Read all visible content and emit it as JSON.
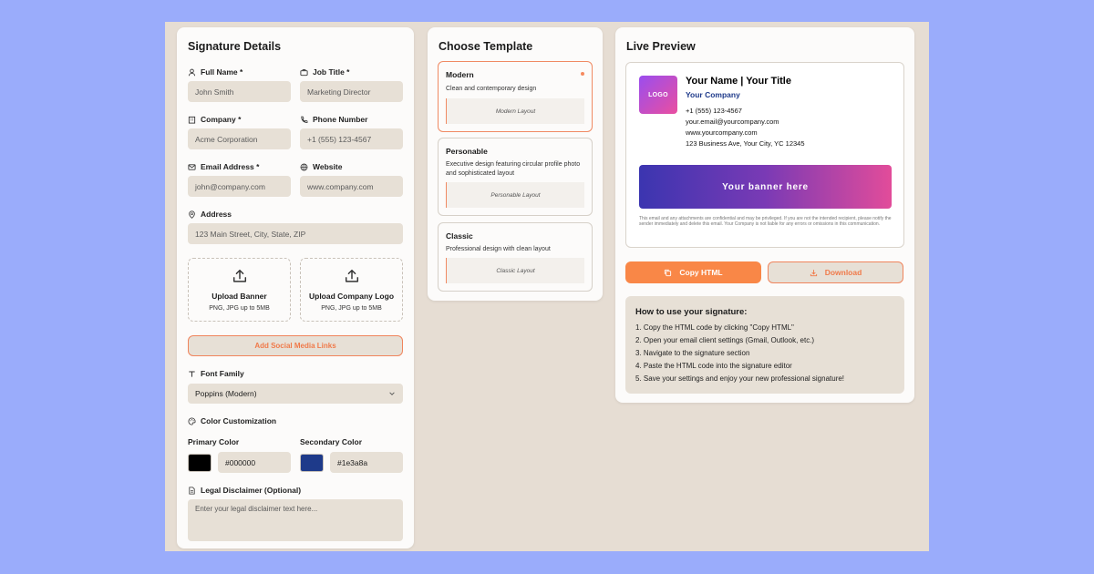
{
  "form": {
    "title": "Signature Details",
    "full_name": {
      "label": "Full Name *",
      "value": "John Smith"
    },
    "job_title": {
      "label": "Job Title *",
      "value": "Marketing Director"
    },
    "company": {
      "label": "Company *",
      "value": "Acme Corporation"
    },
    "phone": {
      "label": "Phone Number",
      "value": "+1 (555) 123-4567"
    },
    "email": {
      "label": "Email Address *",
      "value": "john@company.com"
    },
    "website": {
      "label": "Website",
      "value": "www.company.com"
    },
    "address": {
      "label": "Address",
      "value": "123 Main Street, City, State, ZIP"
    },
    "upload_banner": {
      "title": "Upload Banner",
      "hint": "PNG, JPG up to 5MB"
    },
    "upload_logo": {
      "title": "Upload Company Logo",
      "hint": "PNG, JPG up to 5MB"
    },
    "social_button": "Add Social Media Links",
    "font_family": {
      "label": "Font Family",
      "value": "Poppins (Modern)"
    },
    "colors": {
      "label": "Color Customization",
      "primary_label": "Primary Color",
      "primary_value": "#000000",
      "secondary_label": "Secondary Color",
      "secondary_value": "#1e3a8a"
    },
    "disclaimer": {
      "label": "Legal Disclaimer (Optional)",
      "placeholder": "Enter your legal disclaimer text here..."
    }
  },
  "templates": {
    "title": "Choose Template",
    "items": [
      {
        "name": "Modern",
        "desc": "Clean and contemporary design",
        "preview": "Modern Layout",
        "selected": true
      },
      {
        "name": "Personable",
        "desc": "Executive design featuring circular profile photo and sophisticated layout",
        "preview": "Personable Layout",
        "selected": false
      },
      {
        "name": "Classic",
        "desc": "Professional design with clean layout",
        "preview": "Classic Layout",
        "selected": false
      }
    ]
  },
  "preview": {
    "title": "Live Preview",
    "logo_text": "LOGO",
    "name_title": "Your Name | Your Title",
    "company": "Your Company",
    "phone": "+1 (555) 123-4567",
    "email": "your.email@yourcompany.com",
    "website": "www.yourcompany.com",
    "address": "123 Business Ave, Your City, YC 12345",
    "banner_text": "Your banner here",
    "disclaimer": "This email and any attachments are confidential and may be privileged. If you are not the intended recipient, please notify the sender immediately and delete this email. Your Company is not liable for any errors or omissions in this communication."
  },
  "actions": {
    "copy_html": "Copy HTML",
    "download": "Download"
  },
  "howto": {
    "title": "How to use your signature:",
    "steps": [
      "1. Copy the HTML code by clicking \"Copy HTML\"",
      "2. Open your email client settings (Gmail, Outlook, etc.)",
      "3. Navigate to the signature section",
      "4. Paste the HTML code into the signature editor",
      "5. Save your settings and enjoy your new professional signature!"
    ]
  },
  "colors": {
    "accent": "#f98747",
    "background": "#9aacfb",
    "secondary": "#1e3a8a"
  },
  "icons": [
    "user-icon",
    "briefcase-icon",
    "building-icon",
    "phone-icon",
    "mail-icon",
    "globe-icon",
    "map-pin-icon",
    "upload-icon",
    "type-icon",
    "palette-icon",
    "file-icon",
    "chevron-down-icon",
    "copy-icon",
    "download-icon"
  ]
}
